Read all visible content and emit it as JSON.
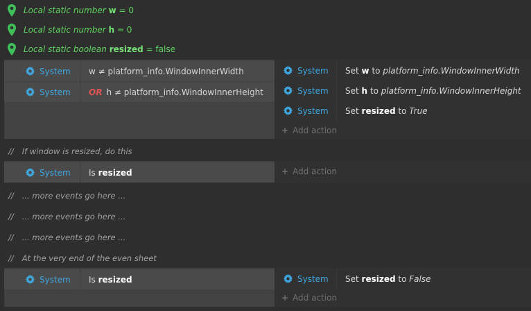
{
  "variables": [
    {
      "prefix": "Local static number",
      "name": "w",
      "value": "= 0"
    },
    {
      "prefix": "Local static number",
      "name": "h",
      "value": "= 0"
    },
    {
      "prefix": "Local static boolean",
      "name": "resized",
      "value": "= false"
    }
  ],
  "event1": {
    "conditions": [
      {
        "object": "System",
        "or": "",
        "text": "w ≠ platform_info.WindowInnerWidth"
      },
      {
        "object": "System",
        "or": "OR",
        "text": "h ≠ platform_info.WindowInnerHeight"
      }
    ],
    "actions": [
      {
        "object": "System",
        "verb": "Set",
        "target": "w",
        "to": "to",
        "value": "platform_info.WindowInnerWidth"
      },
      {
        "object": "System",
        "verb": "Set",
        "target": "h",
        "to": "to",
        "value": "platform_info.WindowInnerHeight"
      },
      {
        "object": "System",
        "verb": "Set",
        "target": "resized",
        "to": "to",
        "value": "True"
      }
    ],
    "add_action": "Add action"
  },
  "comment1": "If window is resized, do this",
  "event2": {
    "conditions": [
      {
        "object": "System",
        "prefix": "Is",
        "name": "resized"
      }
    ],
    "add_action": "Add action"
  },
  "comments": [
    "... more events go here ...",
    "... more events go here ...",
    "... more events go here ..."
  ],
  "comment_end": "At the very end of the even sheet",
  "event3": {
    "conditions": [
      {
        "object": "System",
        "prefix": "Is",
        "name": "resized"
      }
    ],
    "actions": [
      {
        "object": "System",
        "verb": "Set",
        "target": "resized",
        "to": "to",
        "value": "False"
      }
    ],
    "add_action": "Add action"
  },
  "comment_slashes": "//",
  "colors": {
    "background": "#2e2e2e",
    "variable": "#5fd35f",
    "system": "#3fa7e0",
    "or": "#e05555"
  }
}
